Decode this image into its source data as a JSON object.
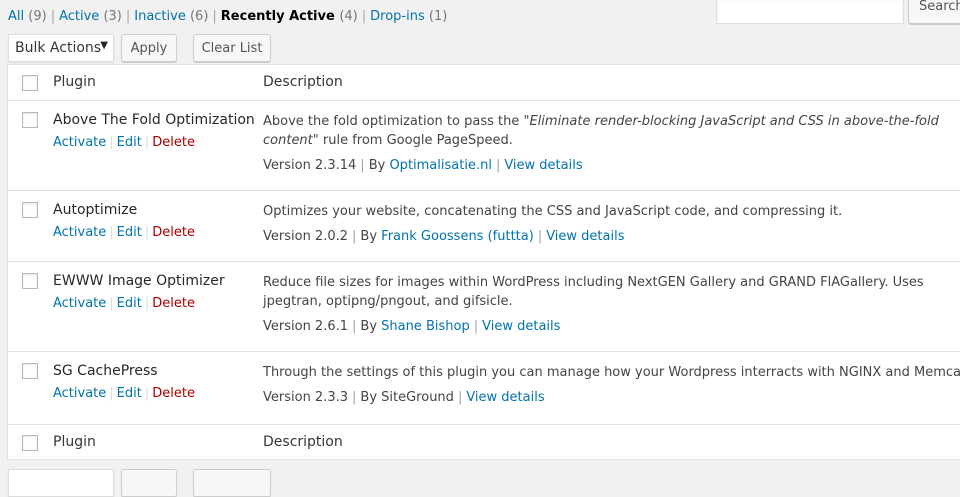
{
  "filters": {
    "all": {
      "label": "All",
      "count": "(9)"
    },
    "active": {
      "label": "Active",
      "count": "(3)"
    },
    "inactive": {
      "label": "Inactive",
      "count": "(6)"
    },
    "recently_active": {
      "label": "Recently Active",
      "count": "(4)"
    },
    "dropins": {
      "label": "Drop-ins",
      "count": "(1)"
    },
    "separator": "|"
  },
  "search": {
    "value": "",
    "button_label": "Search"
  },
  "tablenav": {
    "bulk_actions": "Bulk Actions",
    "apply": "Apply",
    "clear_list": "Clear List"
  },
  "table": {
    "col_plugin": "Plugin",
    "col_description": "Description"
  },
  "actions": {
    "activate": "Activate",
    "edit": "Edit",
    "delete": "Delete",
    "sep": "|"
  },
  "plugins": [
    {
      "name": "Above The Fold Optimization",
      "description_before": "Above the fold optimization to pass the \"",
      "description_em": "Eliminate render-blocking JavaScript and CSS in above-the-fold content",
      "description_after": "\" rule from Google PageSpeed.",
      "version": "Version 2.3.14",
      "by": "By",
      "author": "Optimalisatie.nl",
      "view_details": "View details"
    },
    {
      "name": "Autoptimize",
      "description": "Optimizes your website, concatenating the CSS and JavaScript code, and compressing it.",
      "version": "Version 2.0.2",
      "by": "By",
      "author": "Frank Goossens (futtta)",
      "view_details": "View details"
    },
    {
      "name": "EWWW Image Optimizer",
      "description": "Reduce file sizes for images within WordPress including NextGEN Gallery and GRAND FlAGallery. Uses jpegtran, optipng/pngout, and gifsicle.",
      "version": "Version 2.6.1",
      "by": "By",
      "author": "Shane Bishop",
      "view_details": "View details"
    },
    {
      "name": "SG CachePress",
      "description": "Through the settings of this plugin you can manage how your Wordpress interracts with NGINX and Memcached.",
      "version": "Version 2.3.3",
      "by": "By SiteGround",
      "view_details": "View details"
    }
  ]
}
